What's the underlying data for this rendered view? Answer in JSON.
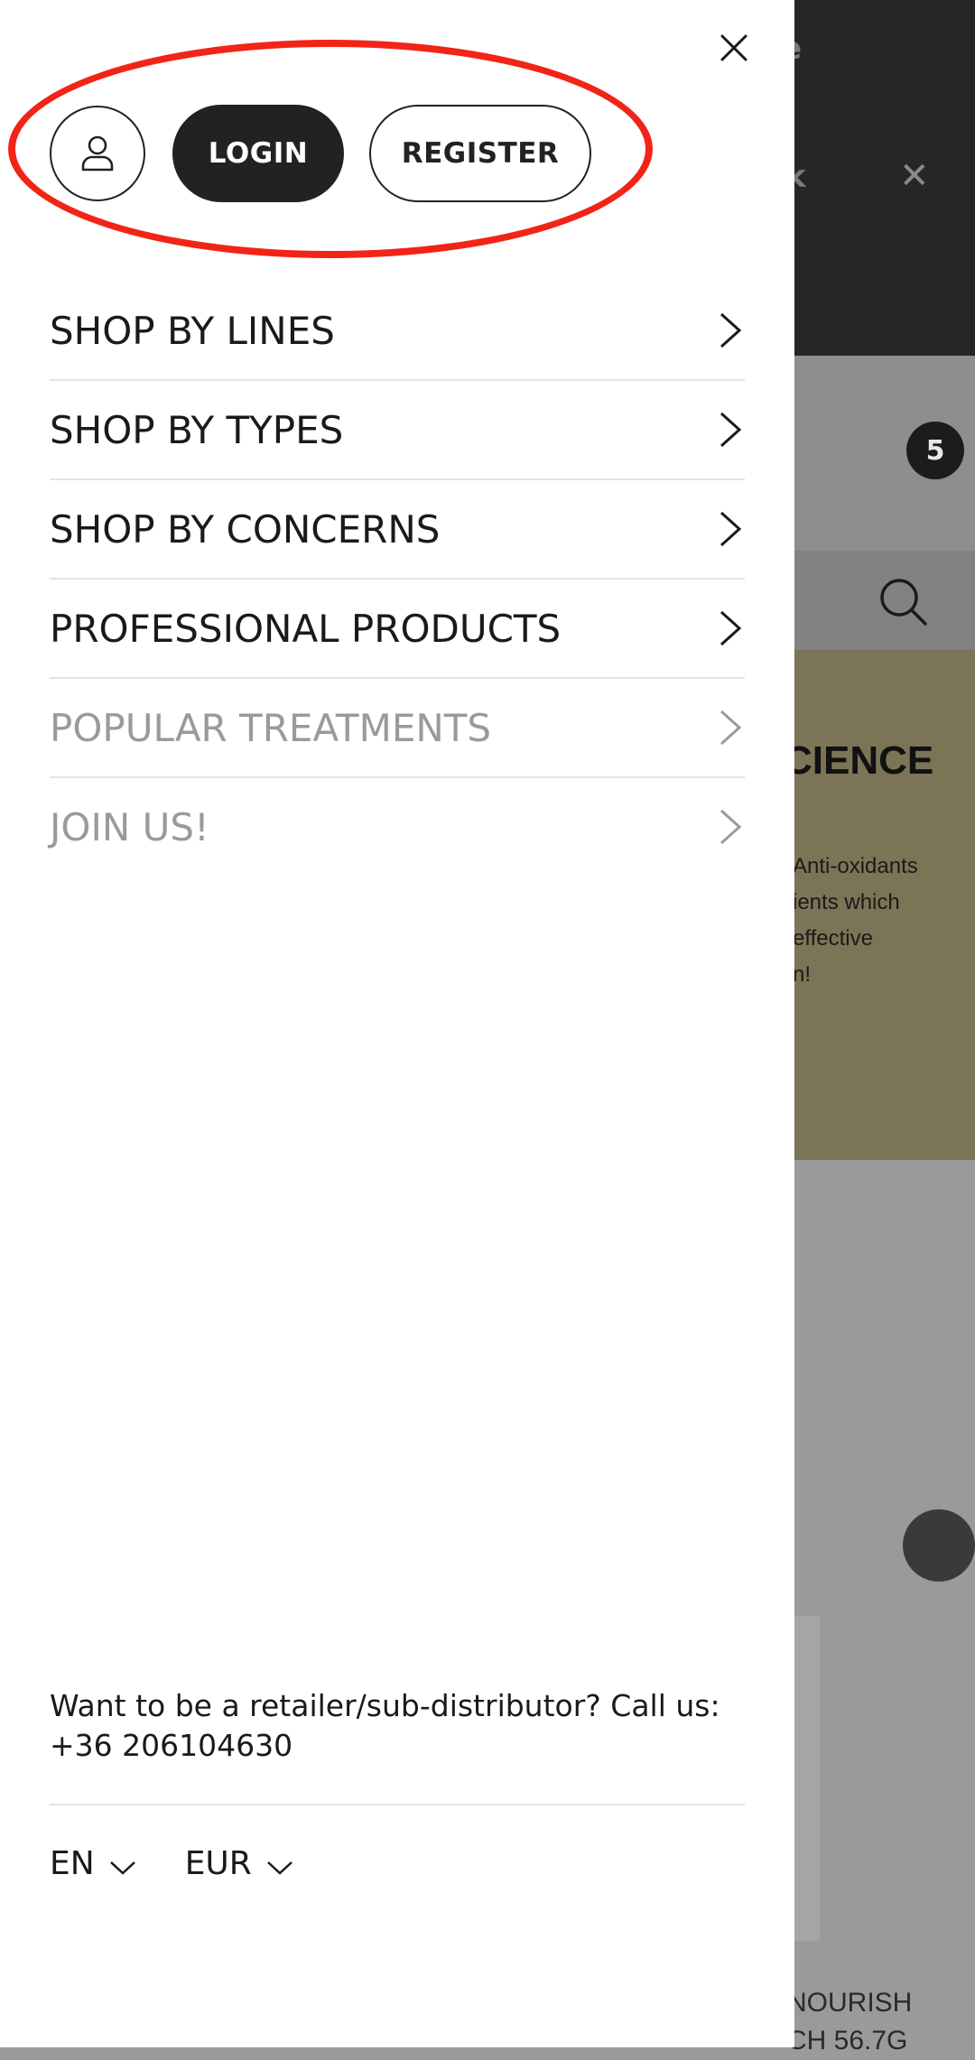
{
  "background": {
    "topbar_text_1": "e",
    "topbar_text_2": "k",
    "cart_count": "5",
    "banner_heading": "CIENCE",
    "banner_lines": [
      "Anti-oxidants",
      "ients which",
      "effective",
      "n!"
    ],
    "bottom_label_lines": [
      "NOURISH",
      "CH 56.7G"
    ]
  },
  "account": {
    "login_label": "LOGIN",
    "register_label": "REGISTER"
  },
  "menu": {
    "items": [
      {
        "label": "SHOP BY LINES"
      },
      {
        "label": "SHOP BY TYPES"
      },
      {
        "label": "SHOP BY CONCERNS"
      },
      {
        "label": "PROFESSIONAL PRODUCTS"
      },
      {
        "label": "POPULAR TREATMENTS"
      },
      {
        "label": "JOIN US!"
      }
    ]
  },
  "footer": {
    "retailer_text": "Want to be a retailer/sub-distributor? Call us:",
    "phone": "+36 206104630",
    "language": "EN",
    "currency": "EUR"
  },
  "colors": {
    "highlight": "#f22417",
    "primary": "#222222",
    "muted_text": "#9a9a9a"
  },
  "icons": {
    "close": "close-icon",
    "user": "user-icon",
    "chevron": "chevron-right-icon",
    "dropdown": "chevron-down-icon",
    "cart": "shopping-bag-icon",
    "search": "search-icon"
  }
}
